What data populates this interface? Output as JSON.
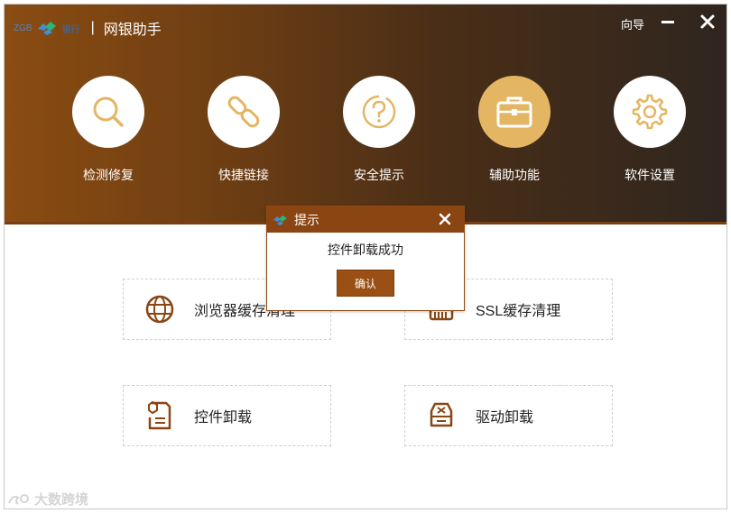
{
  "app": {
    "logo_left": "ZGB",
    "logo_bank": "银行",
    "separator": "|",
    "title": "网银助手",
    "wizard_label": "向导"
  },
  "features": [
    {
      "label": "检测修复",
      "icon": "search-icon",
      "active": false
    },
    {
      "label": "快捷链接",
      "icon": "link-icon",
      "active": false
    },
    {
      "label": "安全提示",
      "icon": "question-icon",
      "active": false
    },
    {
      "label": "辅助功能",
      "icon": "toolbox-icon",
      "active": true
    },
    {
      "label": "软件设置",
      "icon": "gear-icon",
      "active": false
    }
  ],
  "cards": [
    {
      "label": "浏览器缓存清理",
      "icon": "globe-icon"
    },
    {
      "label": "SSL缓存清理",
      "icon": "certificate-icon"
    },
    {
      "label": "控件卸载",
      "icon": "plugin-doc-icon"
    },
    {
      "label": "驱动卸载",
      "icon": "drive-icon"
    }
  ],
  "dialog": {
    "title": "提示",
    "message": "控件卸载成功",
    "ok_label": "确认"
  },
  "watermark": "大数跨境",
  "colors": {
    "accent": "#8a4512",
    "icon_gold": "#e4b664",
    "icon_brown": "#8a4512",
    "header_left": "#8a4c12",
    "header_right": "#2f261f"
  }
}
